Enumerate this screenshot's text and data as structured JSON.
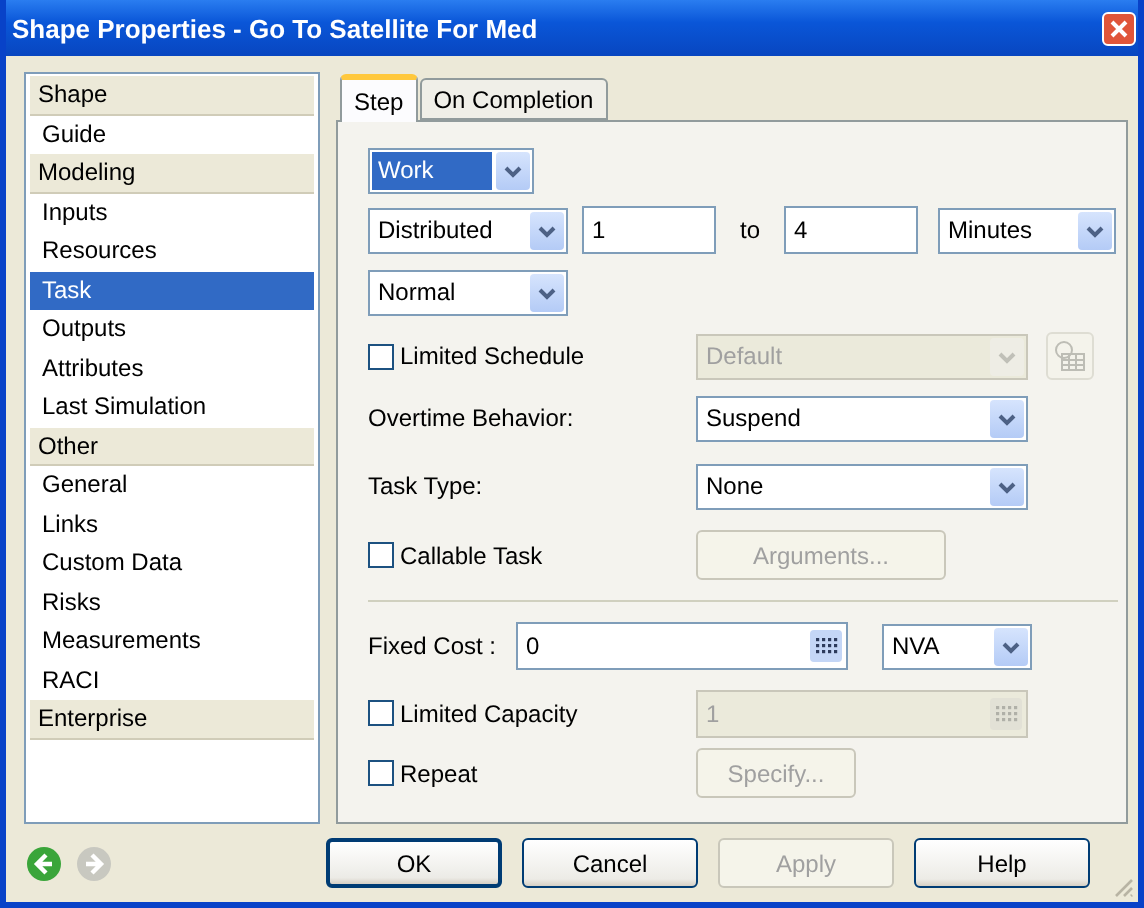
{
  "window": {
    "title": "Shape Properties - Go To Satellite For Med"
  },
  "sidebar": {
    "groups": [
      {
        "header": "Shape",
        "items": [
          {
            "label": "Guide",
            "selected": false
          }
        ]
      },
      {
        "header": "Modeling",
        "items": [
          {
            "label": "Inputs",
            "selected": false
          },
          {
            "label": "Resources",
            "selected": false
          },
          {
            "label": "Task",
            "selected": true
          },
          {
            "label": "Outputs",
            "selected": false
          },
          {
            "label": "Attributes",
            "selected": false
          },
          {
            "label": "Last Simulation",
            "selected": false
          }
        ]
      },
      {
        "header": "Other",
        "items": [
          {
            "label": "General",
            "selected": false
          },
          {
            "label": "Links",
            "selected": false
          },
          {
            "label": "Custom Data",
            "selected": false
          },
          {
            "label": "Risks",
            "selected": false
          },
          {
            "label": "Measurements",
            "selected": false
          },
          {
            "label": "RACI",
            "selected": false
          }
        ]
      },
      {
        "header": "Enterprise"
      }
    ]
  },
  "tabs": [
    {
      "label": "Step",
      "selected": true
    },
    {
      "label": "On Completion",
      "selected": false
    }
  ],
  "step": {
    "work_type": {
      "value": "Work",
      "highlighted": true
    },
    "duration": {
      "distribution": "Distributed",
      "from": "1",
      "to_label": "to",
      "to": "4",
      "unit": "Minutes"
    },
    "distribution_shape": {
      "value": "Normal"
    },
    "limited_schedule": {
      "label": "Limited Schedule",
      "checked": false,
      "schedule": "Default",
      "disabled": true
    },
    "overtime": {
      "label": "Overtime Behavior:",
      "value": "Suspend"
    },
    "task_type": {
      "label": "Task Type:",
      "value": "None"
    },
    "callable": {
      "label": "Callable Task",
      "checked": false,
      "button": "Arguments...",
      "button_disabled": true
    },
    "fixed_cost": {
      "label": "Fixed Cost :",
      "value": "0",
      "category": "NVA"
    },
    "limited_capacity": {
      "label": "Limited Capacity",
      "checked": false,
      "value": "1",
      "disabled": true
    },
    "repeat": {
      "label": "Repeat",
      "checked": false,
      "button": "Specify...",
      "button_disabled": true
    }
  },
  "nav": {
    "back_disabled": false,
    "forward_disabled": true
  },
  "buttons": [
    {
      "label": "OK",
      "disabled": false,
      "default": true
    },
    {
      "label": "Cancel",
      "disabled": false,
      "default": false
    },
    {
      "label": "Apply",
      "disabled": true,
      "default": false
    },
    {
      "label": "Help",
      "disabled": false,
      "default": false
    }
  ]
}
